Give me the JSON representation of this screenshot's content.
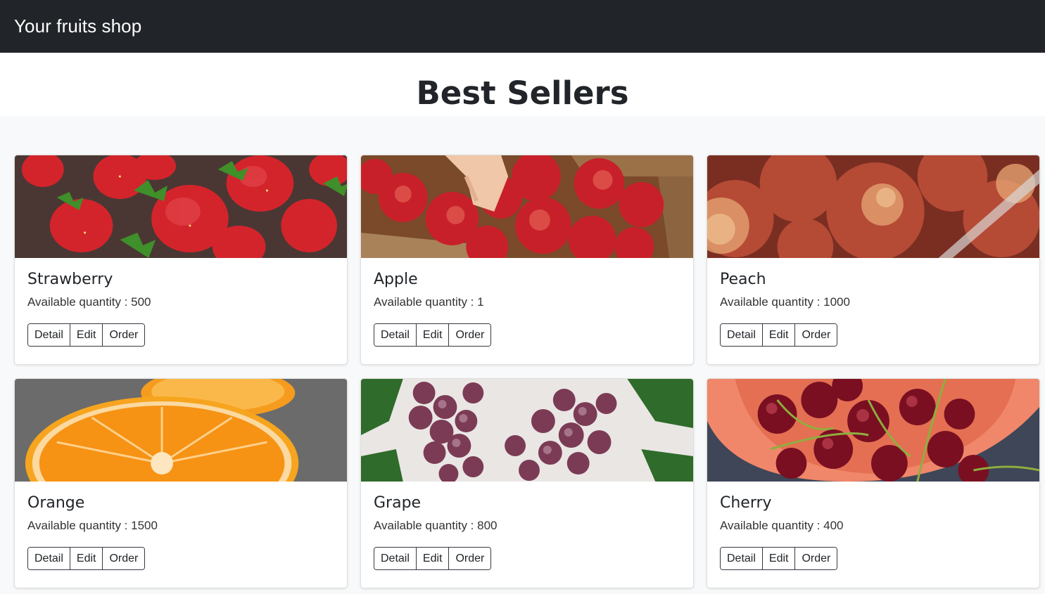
{
  "navbar": {
    "brand": "Your fruits shop"
  },
  "page": {
    "heading": "Best Sellers"
  },
  "products": [
    {
      "name": "Strawberry",
      "quantity_text": "Available quantity : 500",
      "image": "strawberry-image"
    },
    {
      "name": "Apple",
      "quantity_text": "Available quantity : 1",
      "image": "apple-image"
    },
    {
      "name": "Peach",
      "quantity_text": "Available quantity : 1000",
      "image": "peach-image"
    },
    {
      "name": "Orange",
      "quantity_text": "Available quantity : 1500",
      "image": "orange-image"
    },
    {
      "name": "Grape",
      "quantity_text": "Available quantity : 800",
      "image": "grape-image"
    },
    {
      "name": "Cherry",
      "quantity_text": "Available quantity : 400",
      "image": "cherry-image"
    }
  ],
  "buttons": {
    "detail": "Detail",
    "edit": "Edit",
    "order": "Order"
  },
  "colors": {
    "navbar": "#212529",
    "album_bg": "#f8f9fa",
    "button_border": "#343a40"
  }
}
